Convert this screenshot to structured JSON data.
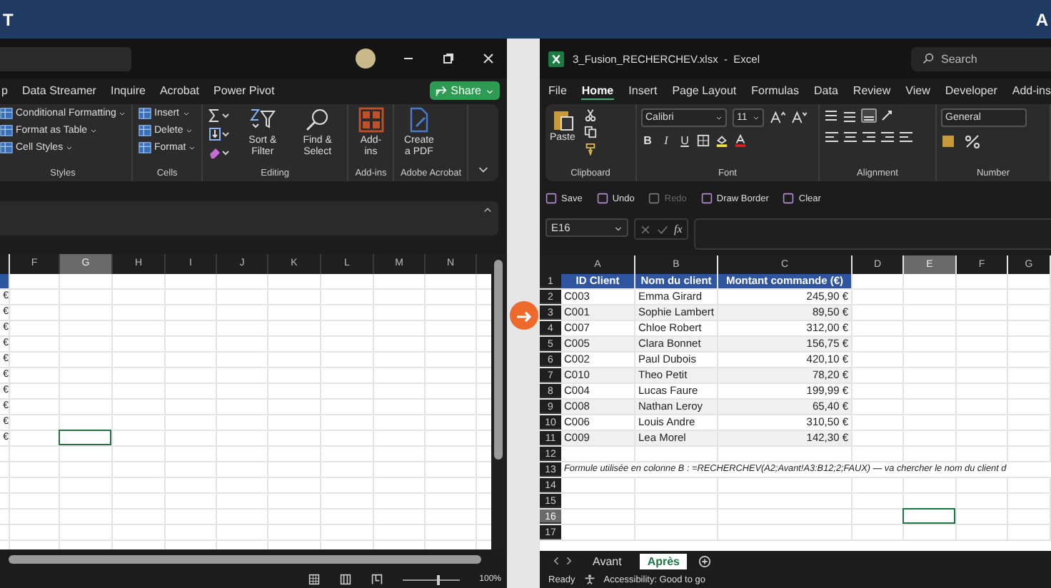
{
  "banner": {
    "left_text": "T",
    "right_text": "A"
  },
  "left_window": {
    "tabs": [
      "p",
      "Data Streamer",
      "Inquire",
      "Acrobat",
      "Power Pivot"
    ],
    "share_button": "Share",
    "ribbon_groups": [
      {
        "label": "Styles",
        "kind": "list",
        "items": [
          "Conditional Formatting",
          "Format as Table",
          "Cell Styles"
        ]
      },
      {
        "label": "Cells",
        "kind": "list",
        "items": [
          "Insert",
          "Delete",
          "Format"
        ]
      },
      {
        "label": "Editing",
        "kind": "editing",
        "items": [
          "Sort & Filter",
          "Find & Select"
        ]
      },
      {
        "label": "Add-ins",
        "kind": "addins",
        "items": [
          "Add-ins"
        ]
      },
      {
        "label": "Adobe Acrobat",
        "kind": "pdf",
        "items": [
          "Create a PDF"
        ]
      }
    ],
    "columns": [
      {
        "label": "F",
        "selected": false
      },
      {
        "label": "G",
        "selected": true
      },
      {
        "label": "H",
        "selected": false
      },
      {
        "label": "I",
        "selected": false
      },
      {
        "label": "J",
        "selected": false
      },
      {
        "label": "K",
        "selected": false
      },
      {
        "label": "L",
        "selected": false
      },
      {
        "label": "M",
        "selected": false
      },
      {
        "label": "N",
        "selected": false
      }
    ],
    "rows": [
      {
        "kind": "header",
        "selected": false
      },
      {
        "kind": "value",
        "text": "€",
        "selected": false
      },
      {
        "kind": "value",
        "text": "€",
        "selected": false
      },
      {
        "kind": "value",
        "text": "€",
        "selected": false
      },
      {
        "kind": "value",
        "text": "€",
        "selected": false
      },
      {
        "kind": "value",
        "text": "€",
        "selected": false
      },
      {
        "kind": "value",
        "text": "€",
        "selected": false
      },
      {
        "kind": "value",
        "text": "€",
        "selected": false
      },
      {
        "kind": "value",
        "text": "€",
        "selected": false
      },
      {
        "kind": "value",
        "text": "€",
        "selected": false
      },
      {
        "kind": "value",
        "text": "€",
        "selected": true
      },
      {
        "kind": "empty",
        "selected": false
      },
      {
        "kind": "empty",
        "selected": false
      },
      {
        "kind": "empty",
        "selected": false
      },
      {
        "kind": "empty",
        "selected": false
      },
      {
        "kind": "empty",
        "selected": false
      },
      {
        "kind": "empty",
        "selected": false
      },
      {
        "kind": "empty",
        "selected": false
      }
    ],
    "zoom_slider": {
      "level": 0.6
    },
    "zoom": "100%"
  },
  "right_window": {
    "title": "3_Fusion_RECHERCHEV.xlsx  -  Excel",
    "search": {
      "placeholder": "Search"
    },
    "tabs": [
      {
        "label": "File",
        "selected": false
      },
      {
        "label": "Home",
        "selected": true
      },
      {
        "label": "Insert",
        "selected": false
      },
      {
        "label": "Page Layout",
        "selected": false
      },
      {
        "label": "Formulas",
        "selected": false
      },
      {
        "label": "Data",
        "selected": false
      },
      {
        "label": "Review",
        "selected": false
      },
      {
        "label": "View",
        "selected": false
      },
      {
        "label": "Developer",
        "selected": false
      },
      {
        "label": "Add-ins",
        "selected": false
      }
    ],
    "paste_label": "Paste",
    "font_name": "Calibri",
    "font_size": "11",
    "format_buttons": [
      "B",
      "I",
      "U"
    ],
    "number_format": "General",
    "ribbon_groups": [
      "Clipboard",
      "Font",
      "Alignment",
      "Number"
    ],
    "quick_actions": [
      {
        "label": "Save",
        "disabled": false
      },
      {
        "label": "Undo",
        "disabled": false
      },
      {
        "label": "Redo",
        "disabled": true
      },
      {
        "label": "Draw Border",
        "disabled": false
      },
      {
        "label": "Clear",
        "disabled": false
      }
    ],
    "name_box": "E16",
    "function_label": "fx",
    "columns": [
      {
        "label": "A",
        "selected": false
      },
      {
        "label": "B",
        "selected": false
      },
      {
        "label": "C",
        "selected": false
      },
      {
        "label": "D",
        "selected": false
      },
      {
        "label": "E",
        "selected": true
      },
      {
        "label": "F",
        "selected": false
      },
      {
        "label": "G",
        "selected": false
      }
    ],
    "rows": [
      {
        "number": "1",
        "kind": "header",
        "selected": false,
        "cells": [
          "ID Client",
          "Nom du client",
          "Montant commande (€)"
        ]
      },
      {
        "number": "2",
        "kind": "data",
        "selected": false,
        "cells": [
          "C003",
          "Emma Girard",
          "245,90 €"
        ]
      },
      {
        "number": "3",
        "kind": "data",
        "selected": false,
        "cells": [
          "C001",
          "Sophie Lambert",
          "89,50 €"
        ]
      },
      {
        "number": "4",
        "kind": "data",
        "selected": false,
        "cells": [
          "C007",
          "Chloe Robert",
          "312,00 €"
        ]
      },
      {
        "number": "5",
        "kind": "data",
        "selected": false,
        "cells": [
          "C005",
          "Clara Bonnet",
          "156,75 €"
        ]
      },
      {
        "number": "6",
        "kind": "data",
        "selected": false,
        "cells": [
          "C002",
          "Paul Dubois",
          "420,10 €"
        ]
      },
      {
        "number": "7",
        "kind": "data",
        "selected": false,
        "cells": [
          "C010",
          "Theo Petit",
          "78,20 €"
        ]
      },
      {
        "number": "8",
        "kind": "data",
        "selected": false,
        "cells": [
          "C004",
          "Lucas Faure",
          "199,99 €"
        ]
      },
      {
        "number": "9",
        "kind": "data",
        "selected": false,
        "cells": [
          "C008",
          "Nathan Leroy",
          "65,40 €"
        ]
      },
      {
        "number": "10",
        "kind": "data",
        "selected": false,
        "cells": [
          "C006",
          "Louis Andre",
          "310,50 €"
        ]
      },
      {
        "number": "11",
        "kind": "data",
        "selected": false,
        "cells": [
          "C009",
          "Lea Morel",
          "142,30 €"
        ]
      },
      {
        "number": "12",
        "kind": "empty",
        "selected": false
      },
      {
        "number": "13",
        "kind": "note",
        "selected": false,
        "text": "Formule utilisée en colonne B : =RECHERCHEV(A2;Avant!A3:B12;2;FAUX) — va chercher le nom du client d"
      },
      {
        "number": "14",
        "kind": "empty",
        "selected": false
      },
      {
        "number": "15",
        "kind": "empty",
        "selected": false
      },
      {
        "number": "16",
        "kind": "empty",
        "selected": true
      },
      {
        "number": "17",
        "kind": "empty",
        "selected": false
      }
    ],
    "sheet_tabs": [
      {
        "label": "Avant",
        "selected": false
      },
      {
        "label": "Après",
        "selected": true
      }
    ],
    "status": "Ready",
    "accessibility": "Accessibility: Good to go"
  }
}
